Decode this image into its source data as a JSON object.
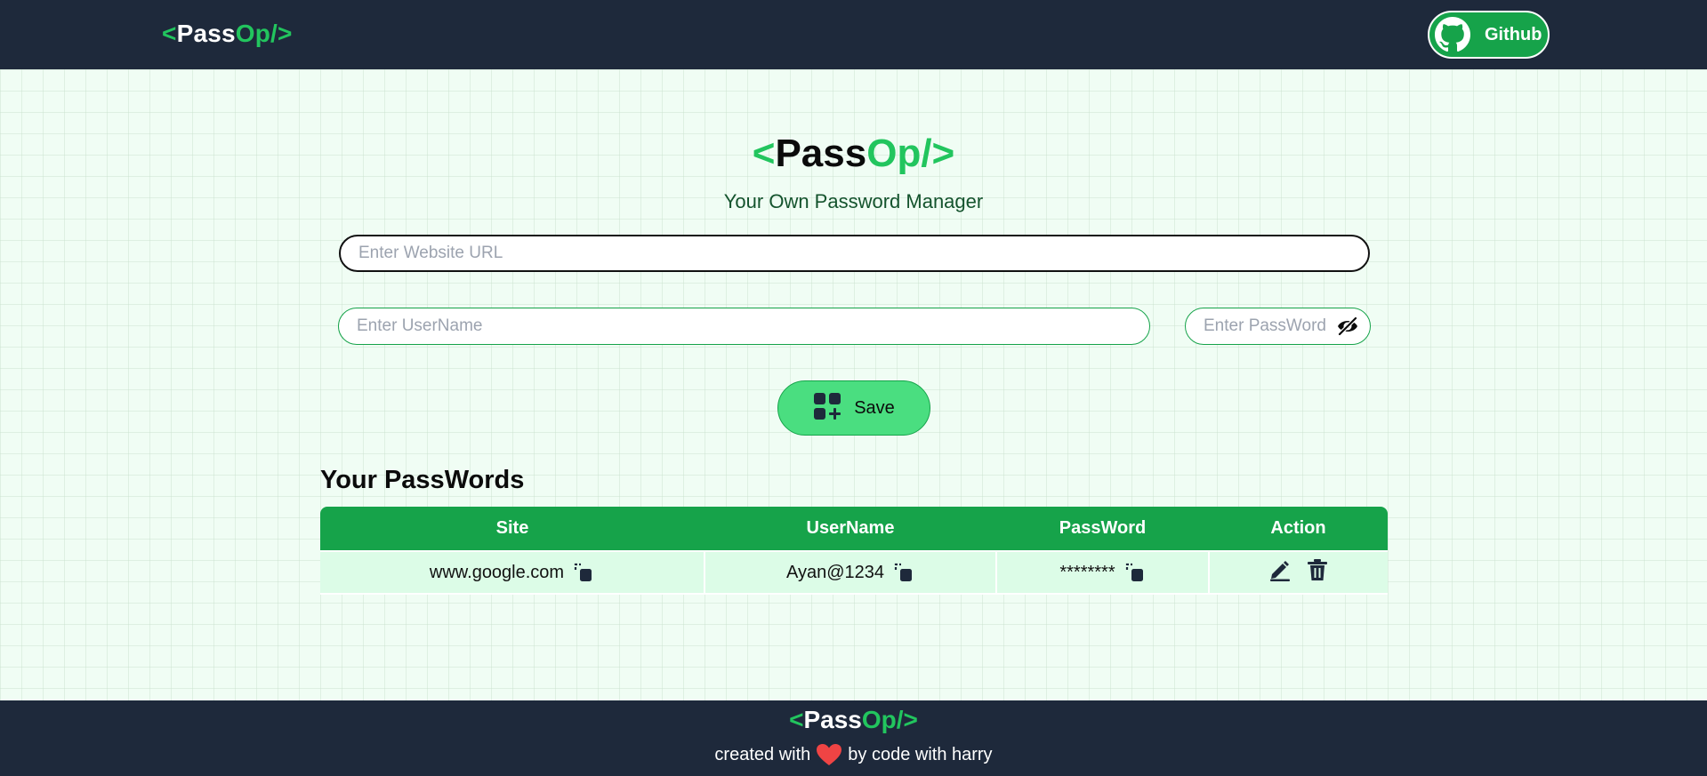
{
  "brand": {
    "bracket_open": "<",
    "pass": "Pass",
    "op_slash": "Op/",
    "bracket_close": ">"
  },
  "navbar": {
    "github_label": "Github",
    "github_icon": "github-icon"
  },
  "header": {
    "subtitle": "Your Own Password Manager"
  },
  "form": {
    "url_placeholder": "Enter Website URL",
    "url_value": "",
    "username_placeholder": "Enter UserName",
    "username_value": "",
    "password_placeholder": "Enter PassWord",
    "password_value": "",
    "password_toggle_icon": "eye-slash-icon",
    "save_label": "Save",
    "save_icon": "add-grid-icon"
  },
  "passwords": {
    "title": "Your PassWords",
    "columns": [
      "Site",
      "UserName",
      "PassWord",
      "Action"
    ],
    "rows": [
      {
        "site": "www.google.com",
        "username": "Ayan@1234",
        "password": "********"
      }
    ]
  },
  "footer": {
    "created_with": "created with",
    "by_text": "by code with harry",
    "heart_icon": "heart-icon"
  },
  "colors": {
    "nav_bg": "#1e293b",
    "accent_green": "#22c55e",
    "button_green": "#4ade80",
    "table_header": "#16a34a",
    "table_row": "#dcfce7",
    "page_bg": "#f0fdf4",
    "heart": "#ef4444"
  }
}
